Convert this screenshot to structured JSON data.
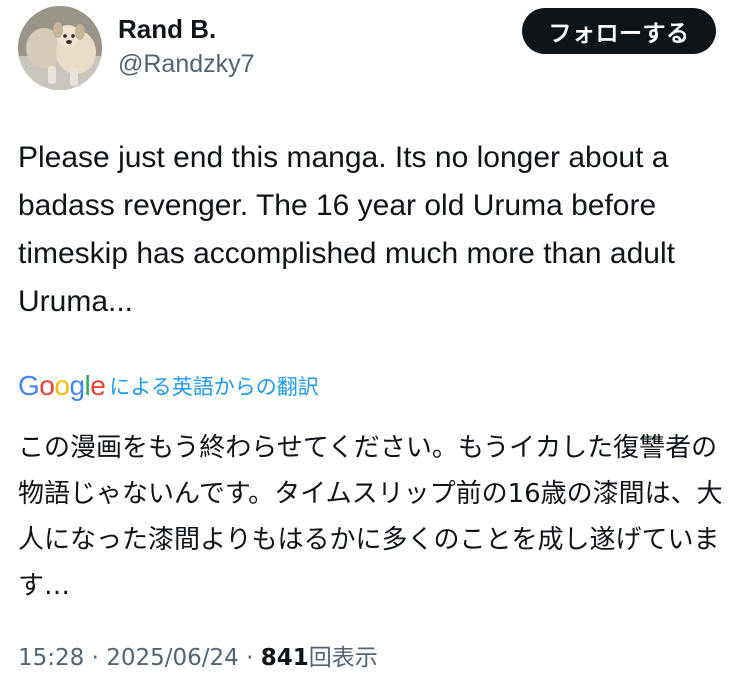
{
  "user": {
    "display_name": "Rand B.",
    "handle": "@Randzky7"
  },
  "follow_button_label": "フォローする",
  "tweet": {
    "text": "Please just end this manga. Its no longer about a badass revenger. The 16 year old Uruma before timeskip has accomplished much more than adult Uruma..."
  },
  "translation": {
    "provider_letters": [
      "G",
      "o",
      "o",
      "g",
      "l",
      "e"
    ],
    "provider_colors": [
      "#4285f4",
      "#ea4335",
      "#fbbc05",
      "#4285f4",
      "#34a853",
      "#ea4335"
    ],
    "label": "による英語からの翻訳",
    "text": "この漫画をもう終わらせてください。もうイカした復讐者の物語じゃないんです。タイムスリップ前の16歳の漆間は、大人になった漆間よりもはるかに多くのことを成し遂げています…"
  },
  "meta": {
    "time": "15:28",
    "separator": "·",
    "date": "2025/06/24",
    "views_count": "841",
    "views_label": "回表示"
  },
  "colors": {
    "text": "#0f1419",
    "secondary": "#536471",
    "link": "#1d9bf0",
    "button_bg": "#0f1419"
  }
}
